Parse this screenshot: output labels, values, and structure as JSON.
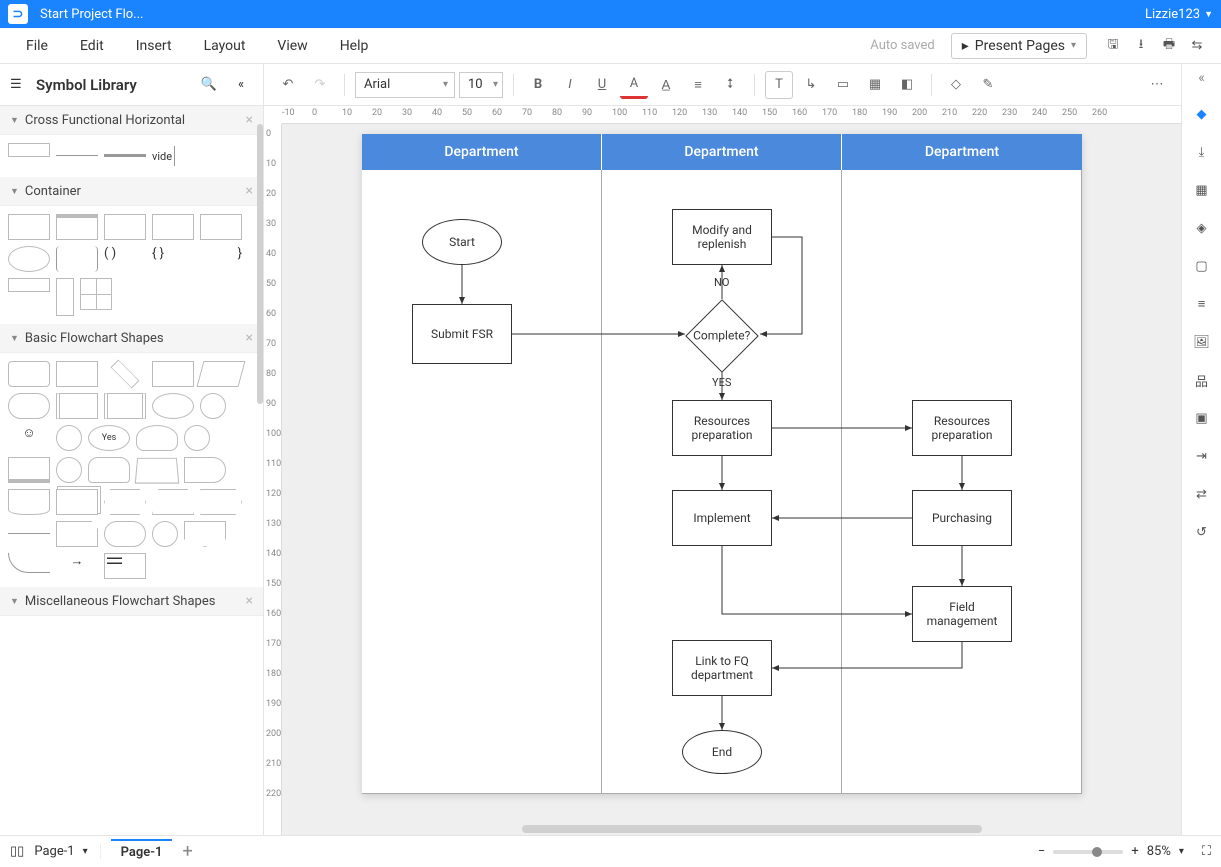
{
  "titlebar": {
    "app_title": "Start Project Flo...",
    "user": "Lizzie123"
  },
  "menu": {
    "file": "File",
    "edit": "Edit",
    "insert": "Insert",
    "layout": "Layout",
    "view": "View",
    "help": "Help",
    "autosaved": "Auto saved",
    "present": "Present Pages"
  },
  "left": {
    "title": "Symbol Library",
    "sections": {
      "cross": "Cross Functional Horizontal",
      "container": "Container",
      "basic": "Basic Flowchart Shapes",
      "misc": "Miscellaneous Flowchart Shapes"
    },
    "vide": "vide",
    "yes_shape": "Yes"
  },
  "toolbar": {
    "font": "Arial",
    "size": "10"
  },
  "ruler_h": [
    "-10",
    "0",
    "10",
    "20",
    "30",
    "40",
    "50",
    "60",
    "70",
    "80",
    "90",
    "100",
    "110",
    "120",
    "130",
    "140",
    "150",
    "160",
    "170",
    "180",
    "190",
    "200",
    "210",
    "220",
    "230",
    "240",
    "250",
    "260"
  ],
  "ruler_v": [
    "0",
    "10",
    "20",
    "30",
    "40",
    "50",
    "60",
    "70",
    "80",
    "90",
    "100",
    "110",
    "120",
    "130",
    "140",
    "150",
    "160",
    "170",
    "180",
    "190",
    "200",
    "210",
    "220"
  ],
  "lanes": {
    "d1": "Department",
    "d2": "Department",
    "d3": "Department"
  },
  "nodes": {
    "start": "Start",
    "submit": "Submit FSR",
    "modify": "Modify and replenish",
    "complete": "Complete?",
    "no": "NO",
    "yes": "YES",
    "res1": "Resources preparation",
    "res2": "Resources preparation",
    "impl": "Implement",
    "purch": "Purchasing",
    "field": "Field management",
    "link": "Link to FQ department",
    "end": "End"
  },
  "status": {
    "page_sel": "Page-1",
    "page_tab": "Page-1",
    "zoom": "85%"
  }
}
